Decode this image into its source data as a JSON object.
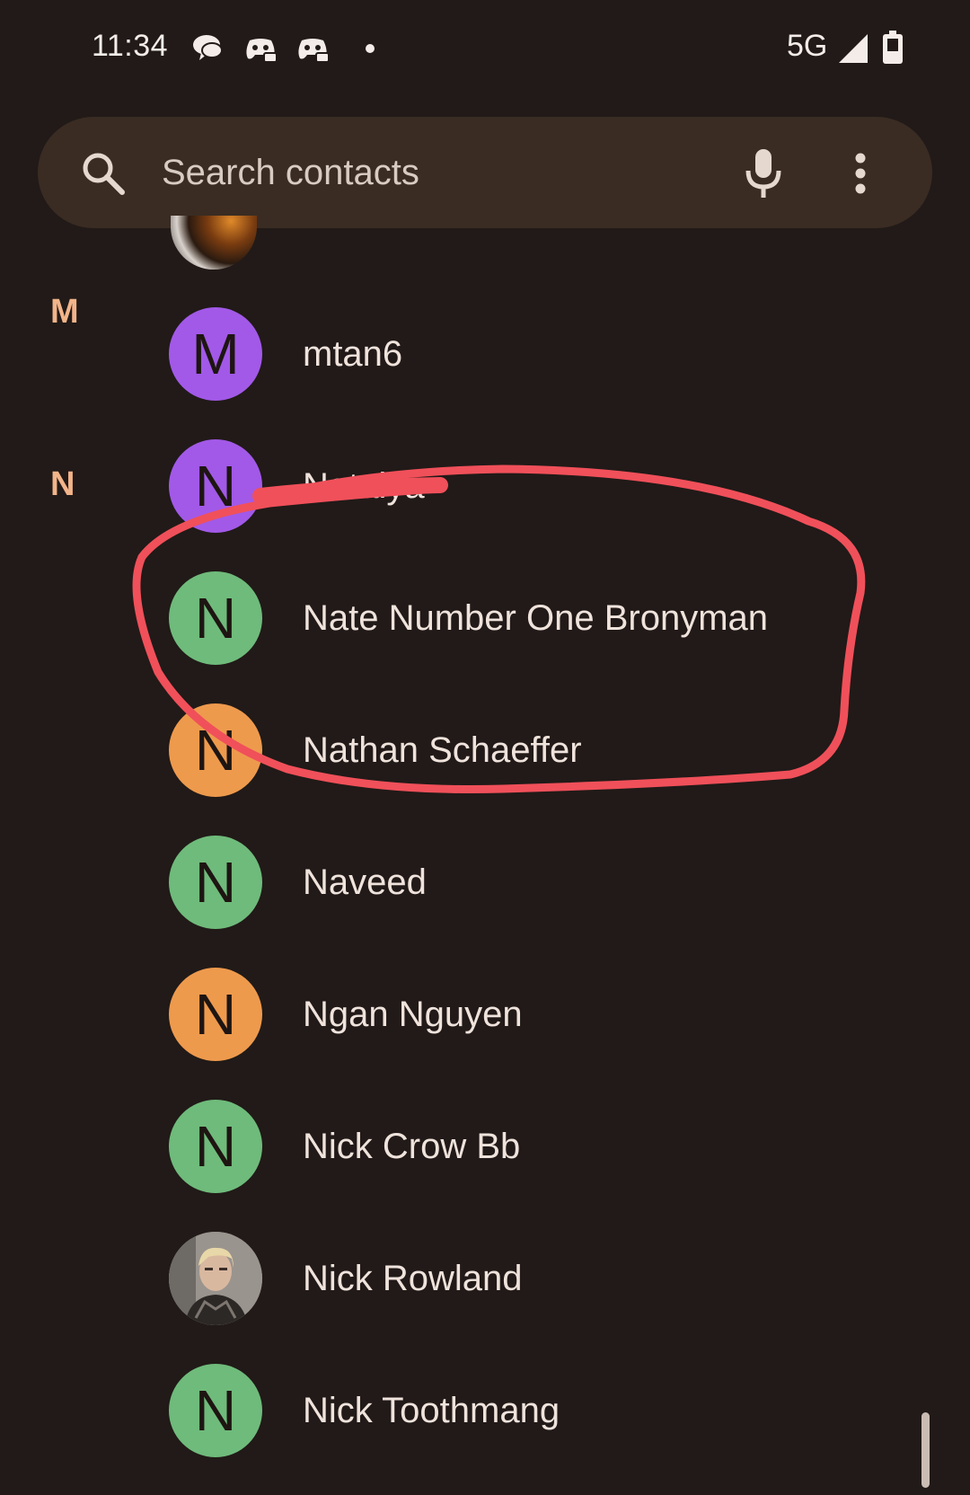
{
  "status_bar": {
    "time": "11:34",
    "network": "5G",
    "notification_icons": [
      "chat-bubbles-icon",
      "gamepad-icon",
      "gamepad-icon",
      "dot-icon"
    ]
  },
  "search": {
    "placeholder": "Search contacts"
  },
  "sections": [
    {
      "letter": "M"
    },
    {
      "letter": "N"
    }
  ],
  "contacts": [
    {
      "name": "mtan6",
      "initial": "M",
      "avatar_color": "#a259e8"
    },
    {
      "name": "Natalya",
      "initial": "N",
      "avatar_color": "#a259e8"
    },
    {
      "name": "Nate Number One Bronyman",
      "initial": "N",
      "avatar_color": "#6fbb7b"
    },
    {
      "name": "Nathan Schaeffer",
      "initial": "N",
      "avatar_color": "#ee9a4d"
    },
    {
      "name": "Naveed",
      "initial": "N",
      "avatar_color": "#6fbb7b"
    },
    {
      "name": "Ngan Nguyen",
      "initial": "N",
      "avatar_color": "#ee9a4d"
    },
    {
      "name": "Nick Crow Bb",
      "initial": "N",
      "avatar_color": "#6fbb7b"
    },
    {
      "name": "Nick Rowland",
      "initial": "",
      "avatar_color": "#8a8580",
      "photo": true
    },
    {
      "name": "Nick Toothmang",
      "initial": "N",
      "avatar_color": "#6fbb7b"
    }
  ],
  "colors": {
    "background": "#211a18",
    "search_bar": "#3a2c23",
    "section_letter": "#f2b48a",
    "annotation": "#f0505a"
  }
}
